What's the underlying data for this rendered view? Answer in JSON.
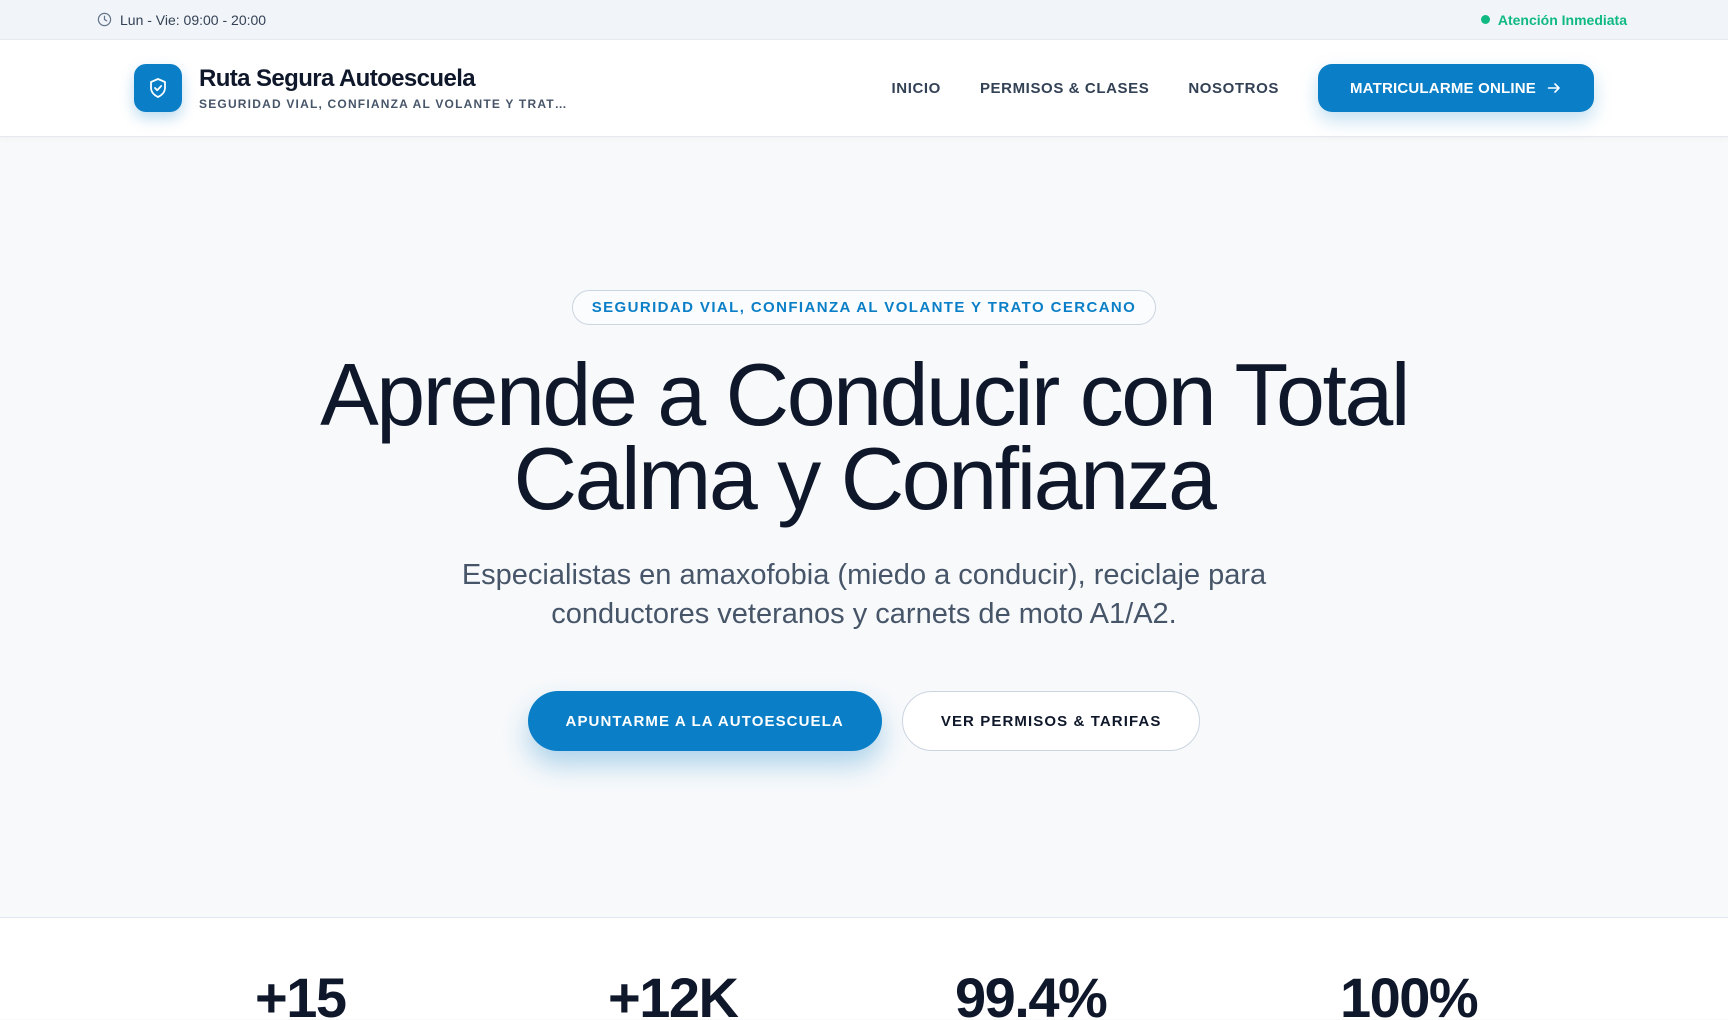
{
  "topbar": {
    "hours": "Lun - Vie: 09:00 - 20:00",
    "status": "Atención Inmediata",
    "status_color": "#10b981"
  },
  "header": {
    "brand_name": "Ruta Segura Autoescuela",
    "brand_tagline": "SEGURIDAD VIAL, CONFIANZA AL VOLANTE Y TRATO CERCANO",
    "nav": [
      "INICIO",
      "PERMISOS & CLASES",
      "NOSOTROS"
    ],
    "cta_label": "MATRICULARME ONLINE"
  },
  "hero": {
    "badge": "SEGURIDAD VIAL, CONFIANZA AL VOLANTE Y TRATO CERCANO",
    "title_line1": "Aprende a Conducir con Total",
    "title_line2": "Calma y Confianza",
    "subtitle": "Especialistas en amaxofobia (miedo a conducir), reciclaje para conductores veteranos y carnets de moto A1/A2.",
    "primary_button": "APUNTARME A LA AUTOESCUELA",
    "secondary_button": "VER PERMISOS & TARIFAS"
  },
  "stats": [
    "+15",
    "+12K",
    "99.4%",
    "100%"
  ],
  "colors": {
    "accent": "#0a7fc7",
    "text_dark": "#0f172a",
    "text_muted": "#475569",
    "background": "#f7f9fb"
  },
  "icons": {
    "hours": "clock-icon",
    "logo": "shield-check-icon",
    "cta": "arrow-right-icon",
    "status": "status-dot-icon"
  }
}
